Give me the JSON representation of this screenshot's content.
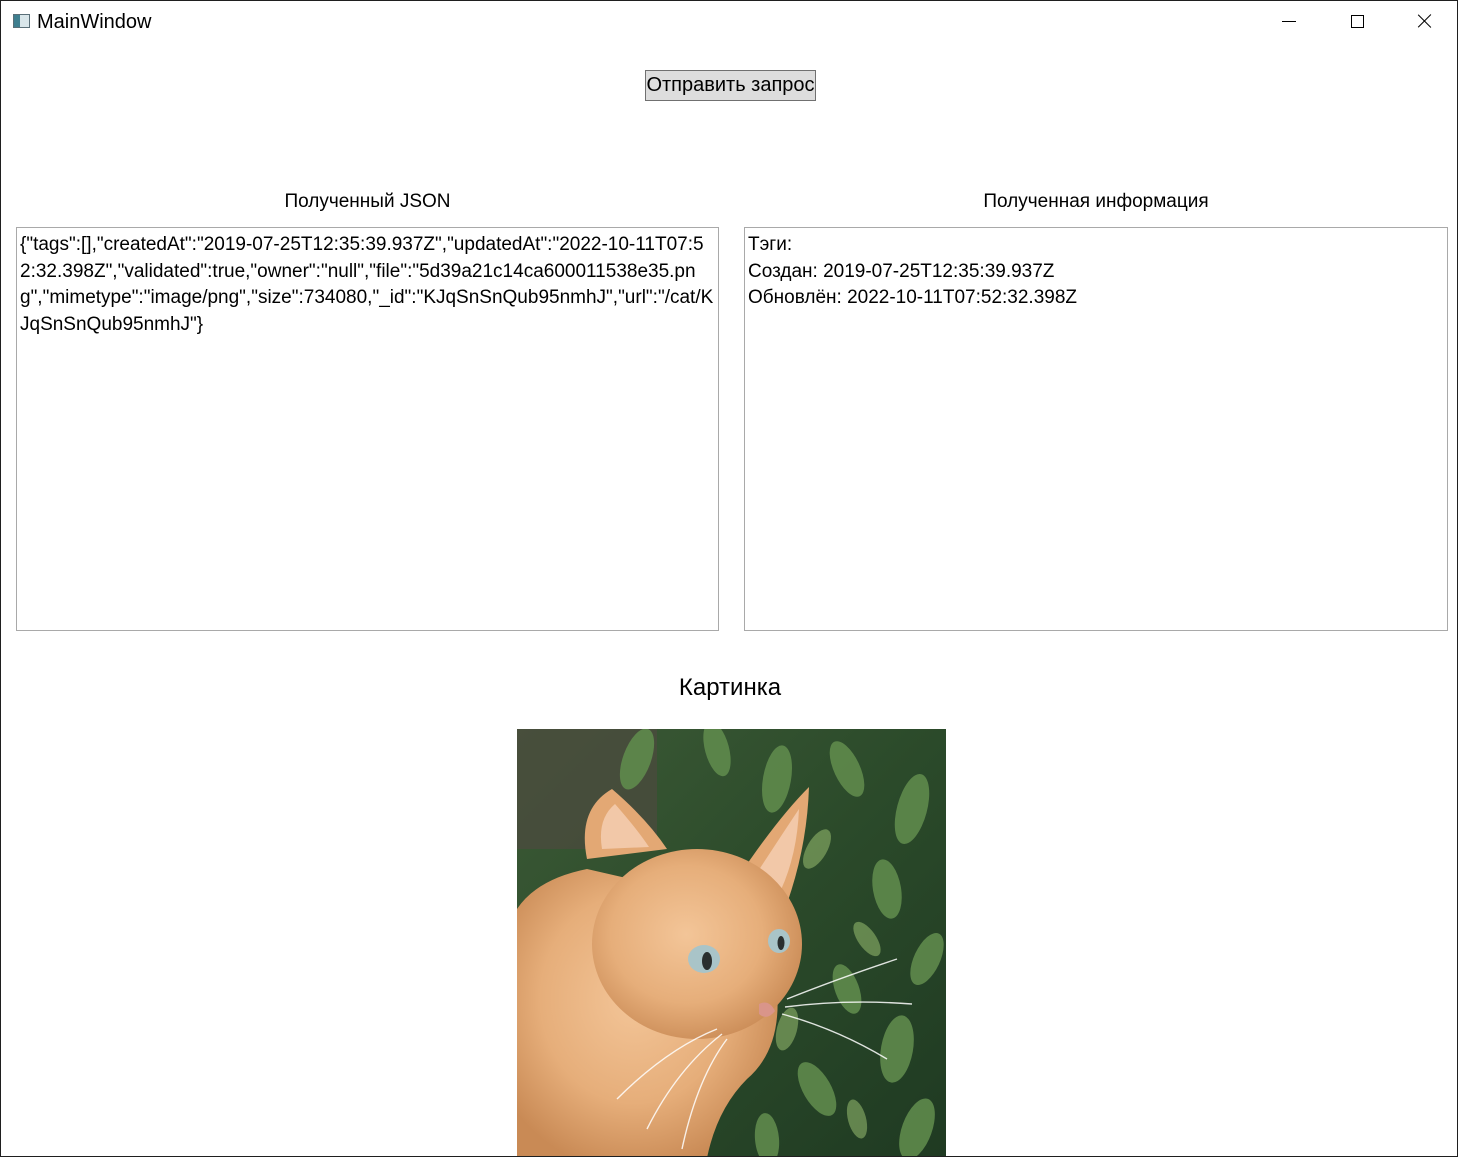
{
  "window": {
    "title": "MainWindow"
  },
  "toolbar": {
    "send_label": "Отправить запрос"
  },
  "json_panel": {
    "title": "Полученный JSON",
    "content": "{\"tags\":[],\"createdAt\":\"2019-07-25T12:35:39.937Z\",\"updatedAt\":\"2022-10-11T07:52:32.398Z\",\"validated\":true,\"owner\":\"null\",\"file\":\"5d39a21c14ca600011538e35.png\",\"mimetype\":\"image/png\",\"size\":734080,\"_id\":\"KJqSnSnQub95nmhJ\",\"url\":\"/cat/KJqSnSnQub95nmhJ\"}"
  },
  "info_panel": {
    "title": "Полученная информация",
    "lines": [
      "Тэги:",
      "Создан: 2019-07-25T12:35:39.937Z",
      "Обновлён: 2022-10-11T07:52:32.398Z"
    ]
  },
  "picture": {
    "title": "Картинка"
  },
  "colors": {
    "button_bg": "#dddddd",
    "button_border": "#707070",
    "textbox_border": "#a9a9a9"
  }
}
